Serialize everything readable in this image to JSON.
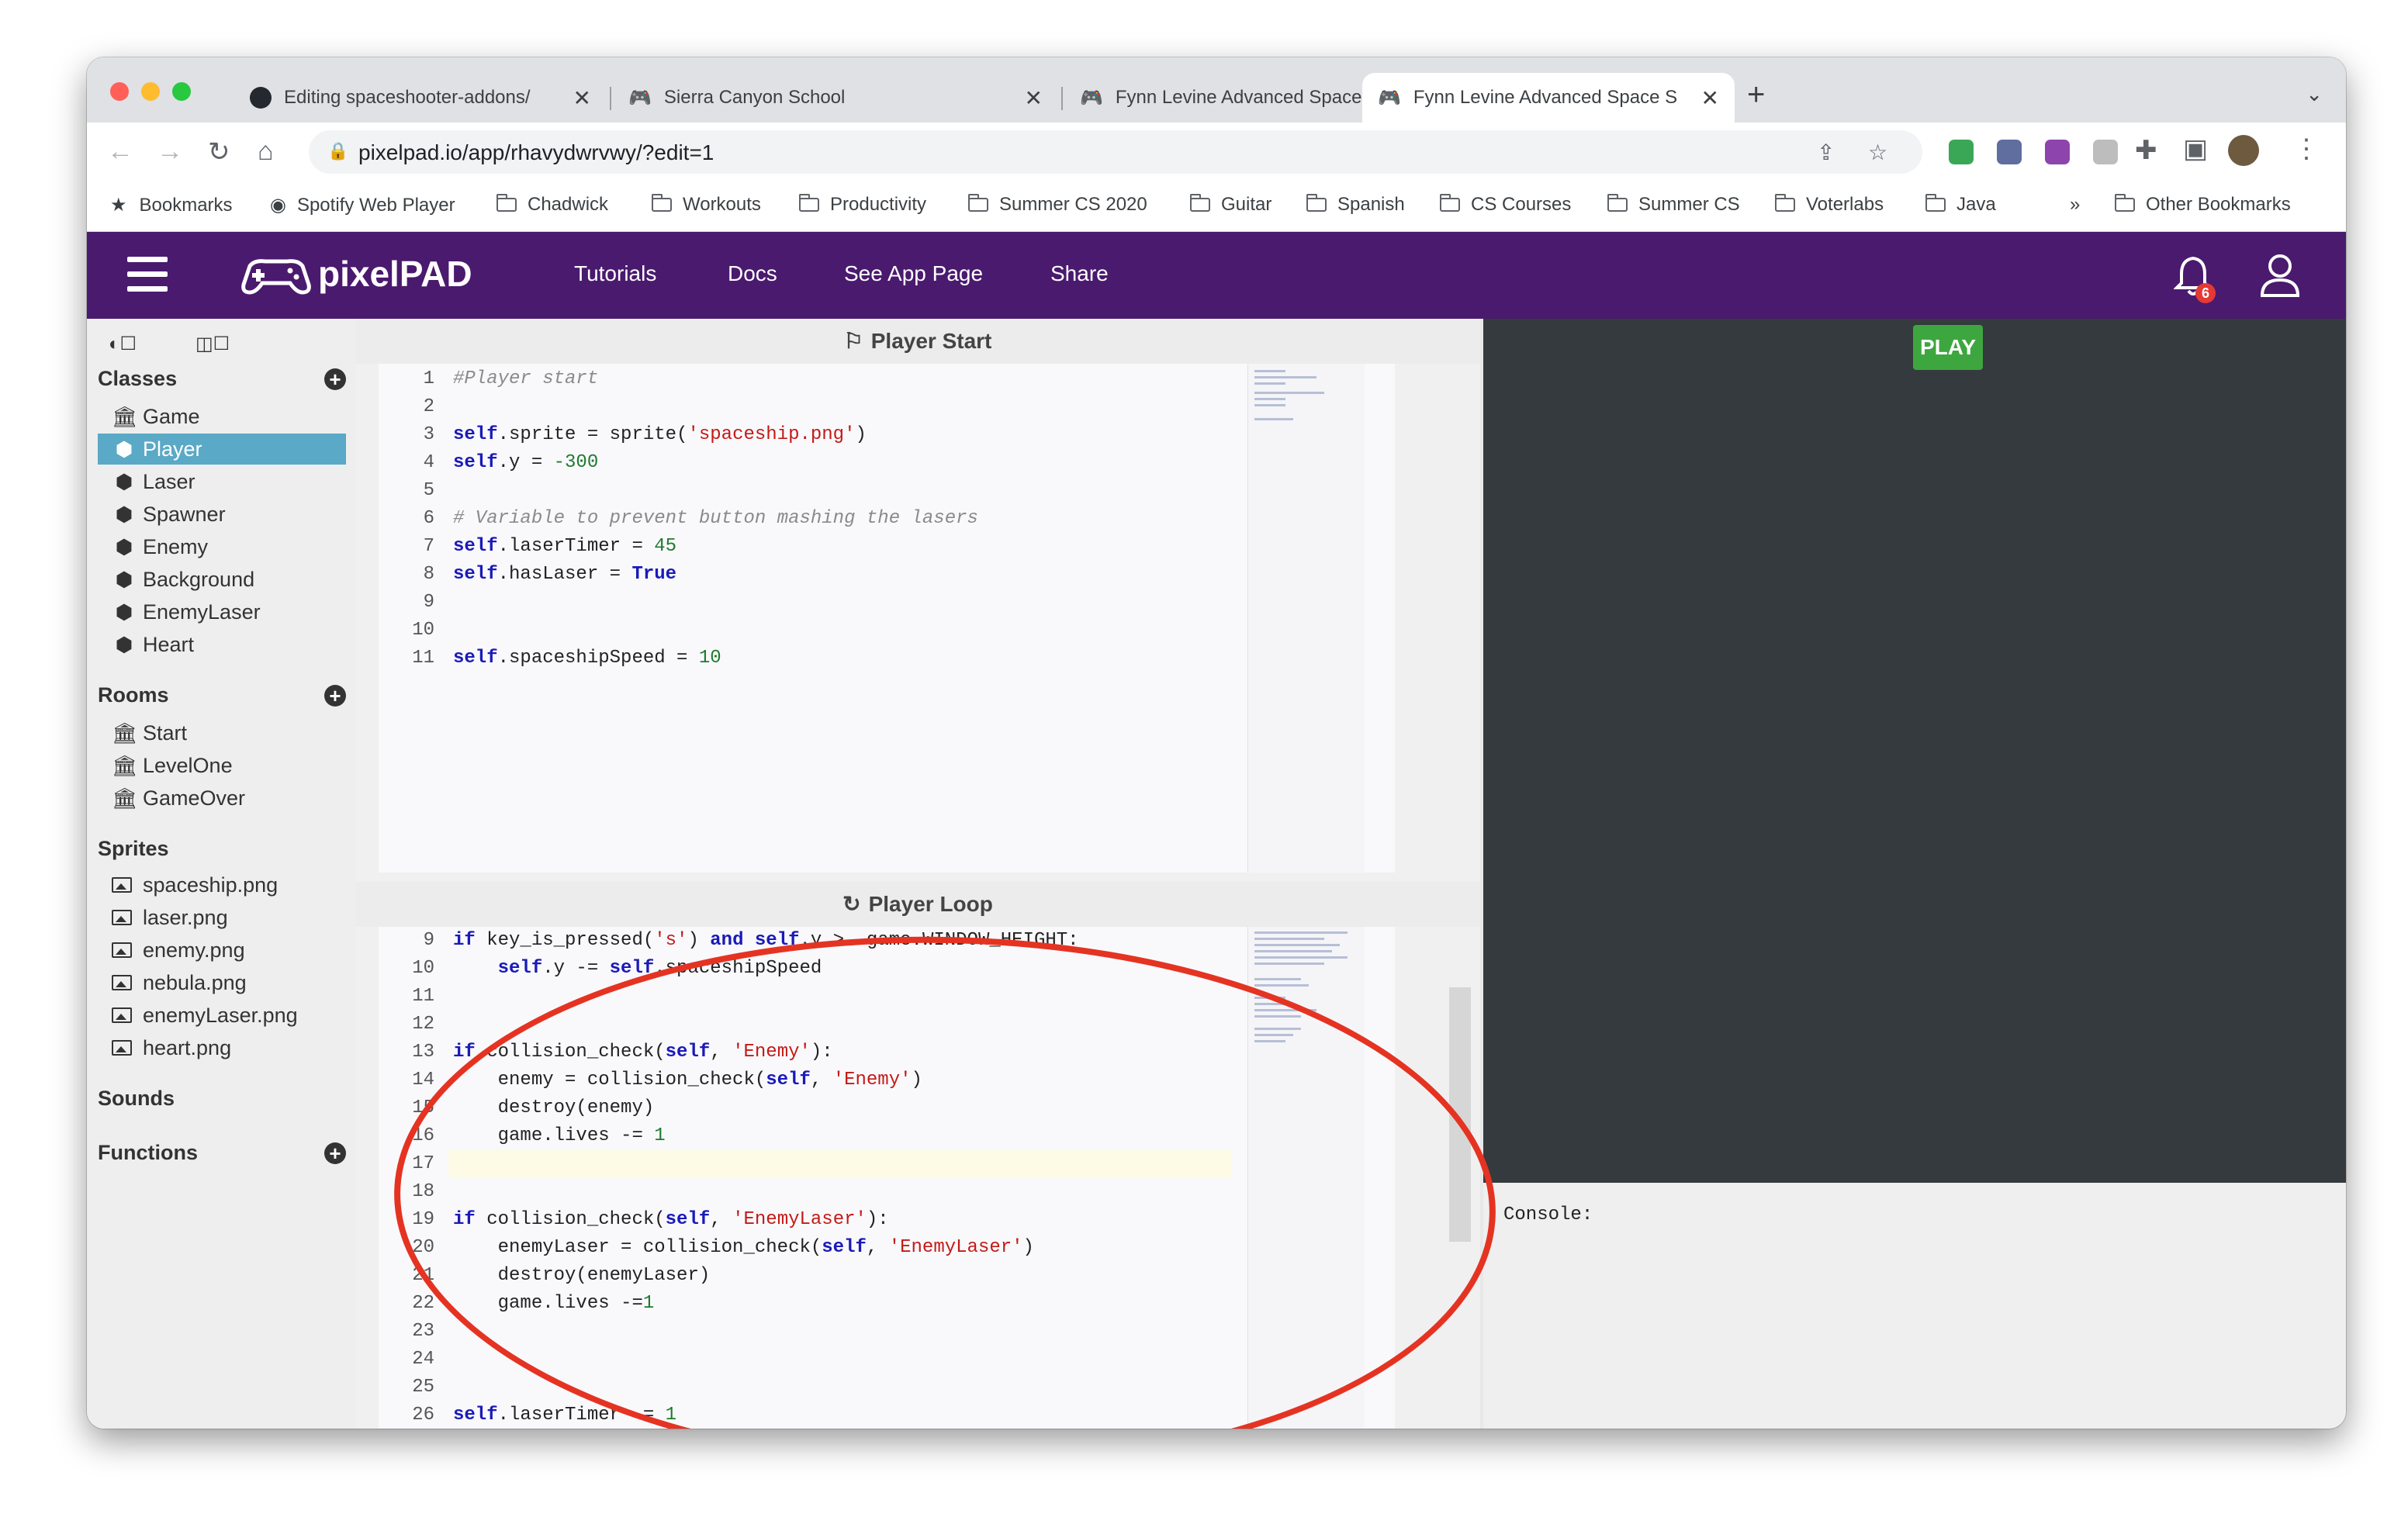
{
  "browser": {
    "tabs": [
      {
        "title": "Editing spaceshooter-addons/"
      },
      {
        "title": "Sierra Canyon School"
      },
      {
        "title": "Fynn Levine Advanced Space S"
      },
      {
        "title": "Fynn Levine Advanced Space S"
      }
    ],
    "new_tab": "+",
    "url": "pixelpad.io/app/rhavydwrvwy/?edit=1",
    "bookmarks": [
      "Bookmarks",
      "Spotify Web Player",
      "Chadwick",
      "Workouts",
      "Productivity",
      "Summer CS 2020",
      "Guitar",
      "Spanish",
      "CS Courses",
      "Summer CS",
      "Voterlabs",
      "Java"
    ],
    "more_bookmarks": "»",
    "other_bookmarks": "Other Bookmarks"
  },
  "header": {
    "logo_text": "pixelPAD",
    "nav": [
      "Tutorials",
      "Docs",
      "See App Page",
      "Share"
    ],
    "notification_count": "6",
    "brand_color": "#4a1a6e"
  },
  "sidebar": {
    "classes_heading": "Classes",
    "classes": [
      "Game",
      "Player",
      "Laser",
      "Spawner",
      "Enemy",
      "Background",
      "EnemyLaser",
      "Heart"
    ],
    "selected_class": "Player",
    "rooms_heading": "Rooms",
    "rooms": [
      "Start",
      "LevelOne",
      "GameOver"
    ],
    "sprites_heading": "Sprites",
    "sprites": [
      "spaceship.png",
      "laser.png",
      "enemy.png",
      "nebula.png",
      "enemyLaser.png",
      "heart.png"
    ],
    "sounds_heading": "Sounds",
    "functions_heading": "Functions"
  },
  "editor": {
    "start_title": "Player Start",
    "start_lines": [
      {
        "n": "1",
        "t": "#Player start"
      },
      {
        "n": "2",
        "t": ""
      },
      {
        "n": "3",
        "t": "self.sprite = sprite('spaceship.png')"
      },
      {
        "n": "4",
        "t": "self.y = -300"
      },
      {
        "n": "5",
        "t": ""
      },
      {
        "n": "6",
        "t": "# Variable to prevent button mashing the lasers"
      },
      {
        "n": "7",
        "t": "self.laserTimer = 45"
      },
      {
        "n": "8",
        "t": "self.hasLaser = True"
      },
      {
        "n": "9",
        "t": ""
      },
      {
        "n": "10",
        "t": ""
      },
      {
        "n": "11",
        "t": "self.spaceshipSpeed = 10"
      }
    ],
    "loop_title": "Player Loop",
    "loop_lines": [
      {
        "n": "9",
        "t": "if key_is_pressed('s') and self.y > -game.WINDOW_HEIGHT:"
      },
      {
        "n": "10",
        "t": "    self.y -= self.spaceshipSpeed"
      },
      {
        "n": "11",
        "t": ""
      },
      {
        "n": "12",
        "t": ""
      },
      {
        "n": "13",
        "t": "if collision_check(self, 'Enemy'):"
      },
      {
        "n": "14",
        "t": "    enemy = collision_check(self, 'Enemy')"
      },
      {
        "n": "15",
        "t": "    destroy(enemy)"
      },
      {
        "n": "16",
        "t": "    game.lives -= 1"
      },
      {
        "n": "17",
        "t": ""
      },
      {
        "n": "18",
        "t": ""
      },
      {
        "n": "19",
        "t": "if collision_check(self, 'EnemyLaser'):"
      },
      {
        "n": "20",
        "t": "    enemyLaser = collision_check(self, 'EnemyLaser')"
      },
      {
        "n": "21",
        "t": "    destroy(enemyLaser)"
      },
      {
        "n": "22",
        "t": "    game.lives -=1"
      },
      {
        "n": "23",
        "t": ""
      },
      {
        "n": "24",
        "t": ""
      },
      {
        "n": "25",
        "t": ""
      },
      {
        "n": "26",
        "t": "self.laserTimer -= 1"
      }
    ]
  },
  "game": {
    "play_label": "PLAY",
    "console_label": "Console:"
  },
  "annotation_color": "#e53322"
}
